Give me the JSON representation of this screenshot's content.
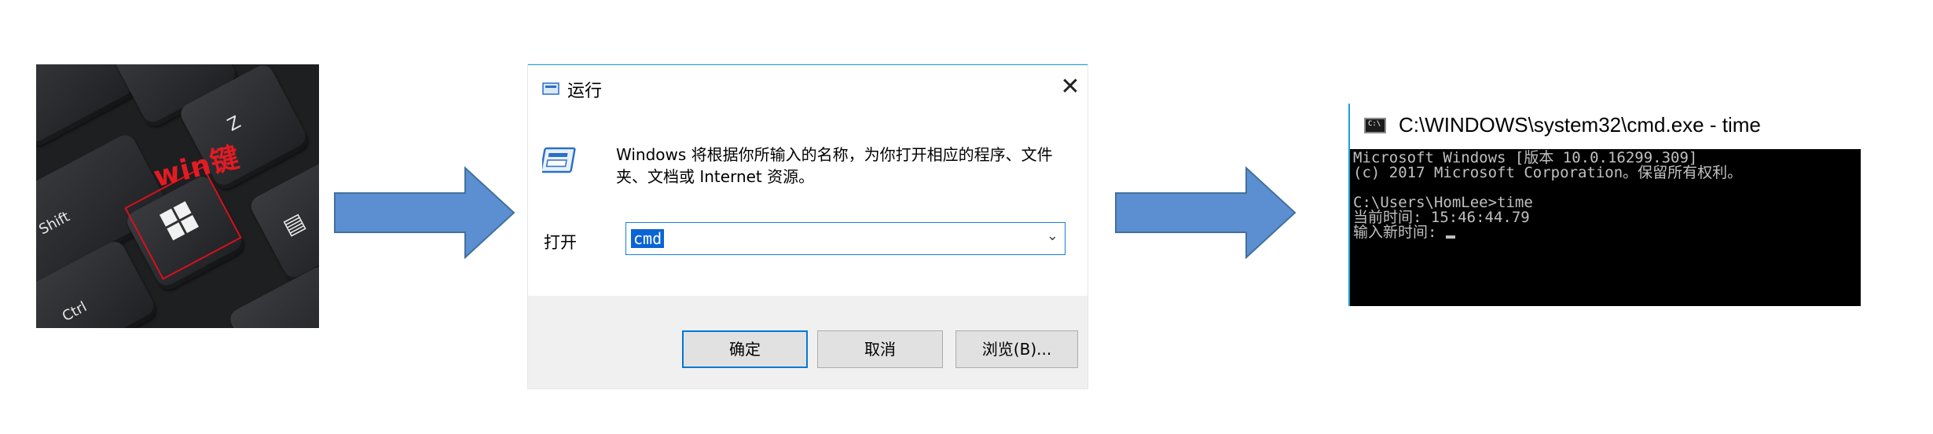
{
  "keyboard_photo": {
    "keys": {
      "z": "Z",
      "shift": "Shift",
      "ctrl": "Ctrl"
    },
    "annotation": "win键",
    "highlight_color": "#e31b23"
  },
  "arrow_color": "#5b8fd1",
  "run_dialog": {
    "title": "运行",
    "close_glyph": "✕",
    "description": "Windows 将根据你所输入的名称，为你打开相应的程序、文件夹、文档或 Internet 资源。",
    "open_label": "打开",
    "input_value": "cmd",
    "dropdown_glyph": "⌄",
    "buttons": {
      "ok": "确定",
      "cancel": "取消",
      "browse": "浏览(B)..."
    }
  },
  "cmd_window": {
    "icon_text": "C:\\",
    "title": "C:\\WINDOWS\\system32\\cmd.exe - time",
    "lines": [
      "Microsoft Windows [版本 10.0.16299.309]",
      "(c) 2017 Microsoft Corporation。保留所有权利。",
      "",
      "C:\\Users\\HomLee>time",
      "当前时间: 15:46:44.79",
      "输入新时间: "
    ]
  }
}
